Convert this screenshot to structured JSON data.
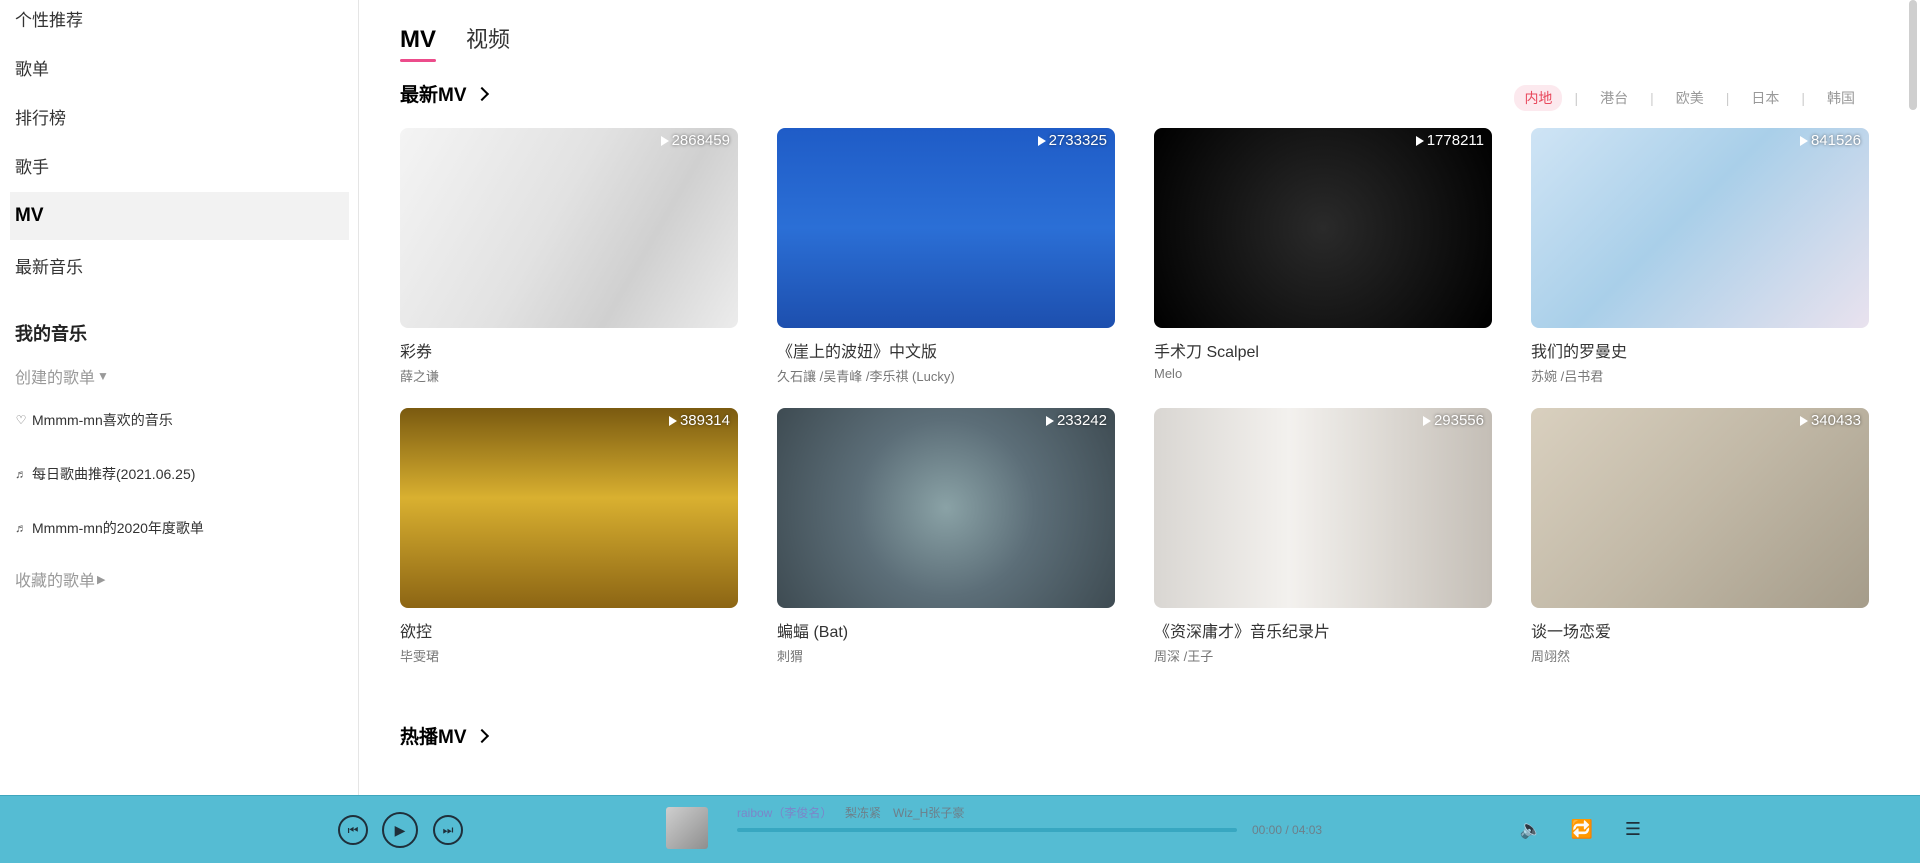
{
  "sidebar": {
    "nav": [
      {
        "label": "个性推荐"
      },
      {
        "label": "歌单"
      },
      {
        "label": "排行榜"
      },
      {
        "label": "歌手"
      },
      {
        "label": "MV"
      },
      {
        "label": "最新音乐"
      }
    ],
    "my_music_title": "我的音乐",
    "created_label": "创建的歌单",
    "created_icon": "caret-down-icon",
    "playlists": [
      {
        "icon": "heart-icon",
        "glyph": "♡",
        "label": "Mmmm-mn喜欢的音乐"
      },
      {
        "icon": "music-list-icon",
        "glyph": "♬",
        "label": "每日歌曲推荐(2021.06.25)"
      },
      {
        "icon": "music-list-icon",
        "glyph": "♬",
        "label": "Mmmm-mn的2020年度歌单"
      }
    ],
    "collected_label": "收藏的歌单",
    "collected_icon": "caret-right-icon"
  },
  "tabs": [
    {
      "label": "MV"
    },
    {
      "label": "视频"
    }
  ],
  "latest_mv": {
    "title": "最新MV",
    "regions": [
      "内地",
      "港台",
      "欧美",
      "日本",
      "韩国"
    ],
    "cards": [
      {
        "count": "2868459",
        "title": "彩券",
        "artist": "薛之谦"
      },
      {
        "count": "2733325",
        "title": "《崖上的波妞》中文版",
        "artist": "久石讓 /吴青峰 /李乐祺 (Lucky)"
      },
      {
        "count": "1778211",
        "title": "手术刀 Scalpel",
        "artist": "Melo"
      },
      {
        "count": "841526",
        "title": "我们的罗曼史",
        "artist": "苏婉 /吕书君"
      },
      {
        "count": "389314",
        "title": "欲控",
        "artist": "毕雯珺"
      },
      {
        "count": "233242",
        "title": "蝙蝠 (Bat)",
        "artist": "刺猬"
      },
      {
        "count": "293556",
        "title": "《资深庸才》音乐纪录片",
        "artist": "周深 /王子"
      },
      {
        "count": "340433",
        "title": "谈一场恋爱",
        "artist": "周翊然"
      }
    ]
  },
  "hot_mv": {
    "title": "热播MV"
  },
  "player": {
    "song_title": "raibow（李俊名）",
    "song_artist": "梨冻紧　Wiz_H张子豪",
    "time": "00:00 / 04:03",
    "progress": 0
  },
  "colors": {
    "accent": "#ec4c8b",
    "region_active": "#e8495d",
    "player_bg": "#55bcd3"
  }
}
